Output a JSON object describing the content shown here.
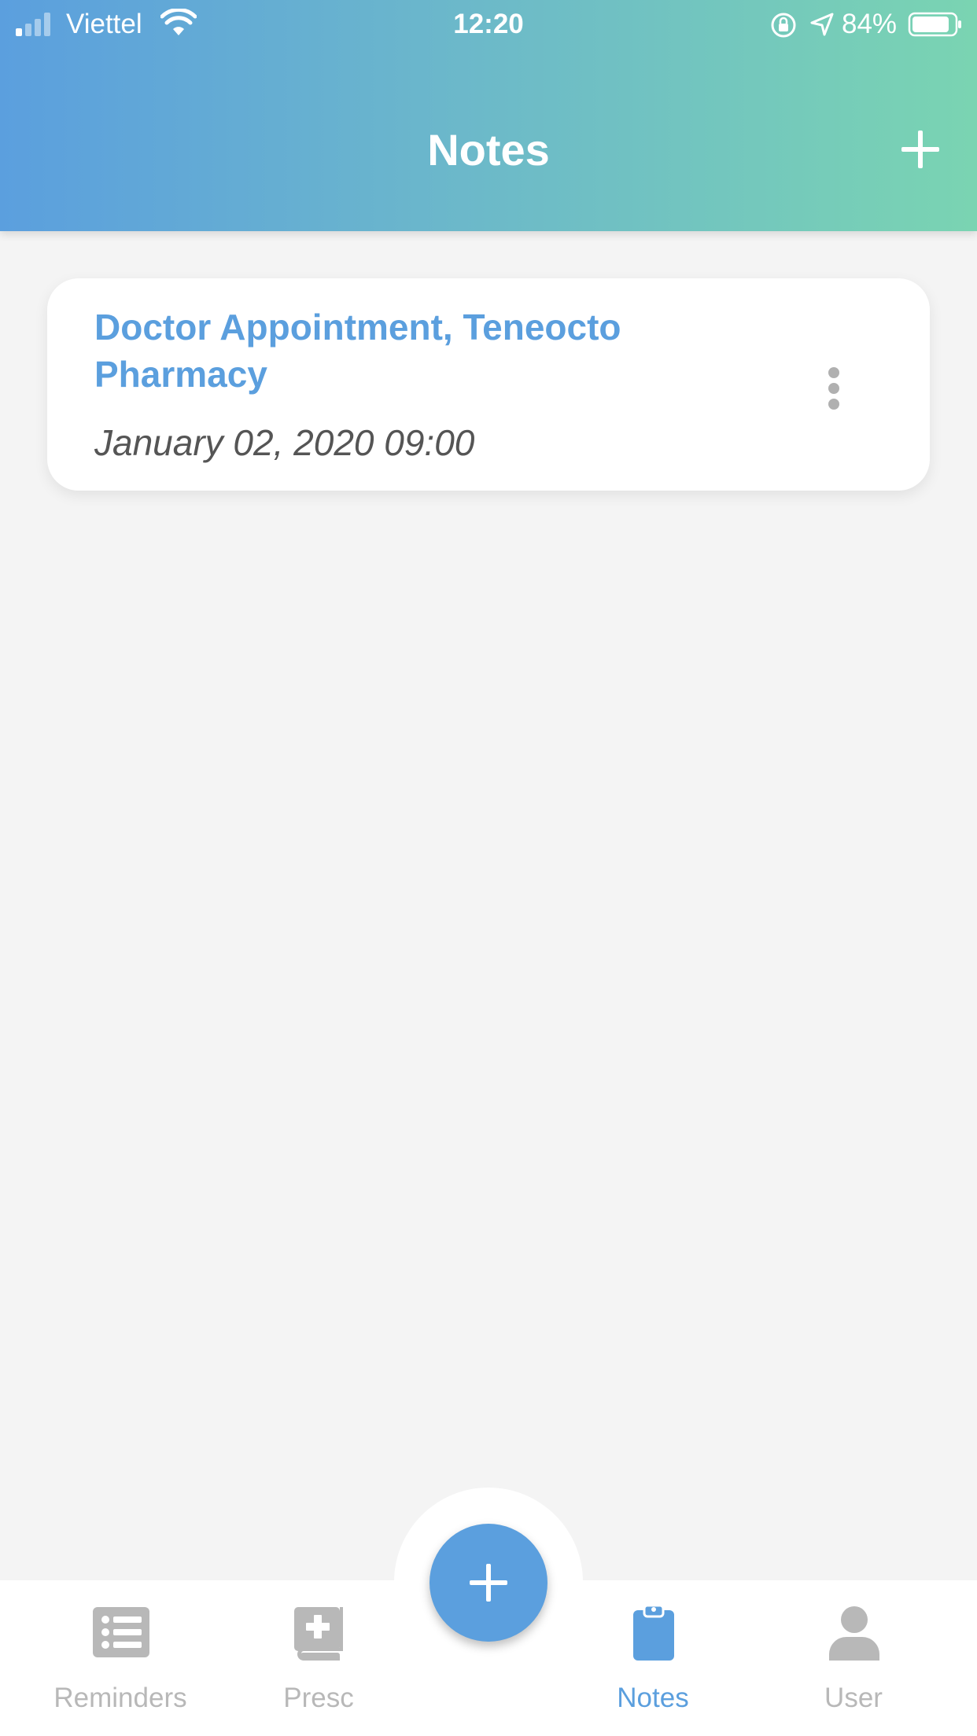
{
  "status_bar": {
    "carrier": "Viettel",
    "time": "12:20",
    "battery": "84%"
  },
  "header": {
    "title": "Notes"
  },
  "notes": [
    {
      "title": "Doctor Appointment, Teneocto Pharmacy",
      "date": "January 02, 2020 09:00"
    }
  ],
  "tabs": [
    {
      "label": "Reminders",
      "icon": "list-icon"
    },
    {
      "label": "Presc",
      "icon": "medical-book-icon"
    },
    {
      "label": "Notes",
      "icon": "clipboard-icon",
      "active": true
    },
    {
      "label": "User",
      "icon": "user-icon"
    }
  ],
  "colors": {
    "accent": "#5b9fde",
    "header_start": "#5b9fde",
    "header_end": "#7ad4b2",
    "inactive": "#b8b8b8"
  }
}
